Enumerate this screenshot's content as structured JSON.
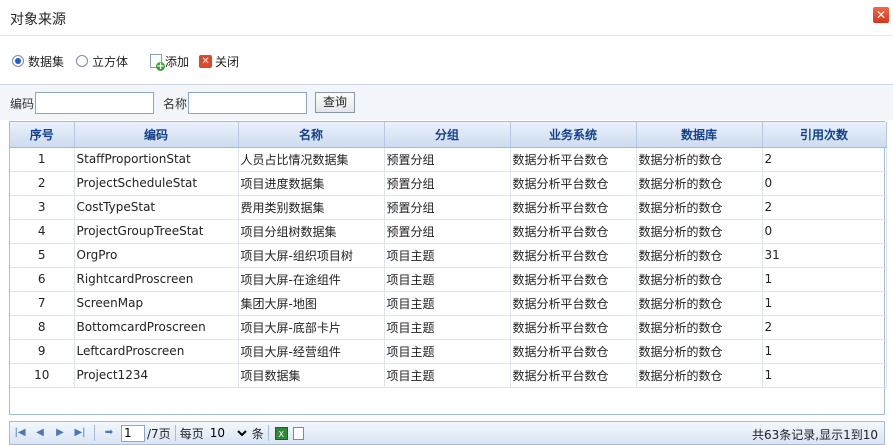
{
  "dialog": {
    "title": "对象来源",
    "close_label": "✕"
  },
  "toolbar": {
    "radio_dataset": "数据集",
    "radio_cube": "立方体",
    "add_label": "添加",
    "close_label": "关闭"
  },
  "filter": {
    "code_label": "编码",
    "code_value": "",
    "name_label": "名称",
    "name_value": "",
    "query_label": "查询"
  },
  "table": {
    "headers": [
      "序号",
      "编码",
      "名称",
      "分组",
      "业务系统",
      "数据库",
      "引用次数"
    ],
    "rows": [
      [
        "1",
        "StaffProportionStat",
        "人员占比情况数据集",
        "预置分组",
        "数据分析平台数仓",
        "数据分析的数仓",
        "2"
      ],
      [
        "2",
        "ProjectScheduleStat",
        "项目进度数据集",
        "预置分组",
        "数据分析平台数仓",
        "数据分析的数仓",
        "0"
      ],
      [
        "3",
        "CostTypeStat",
        "费用类别数据集",
        "预置分组",
        "数据分析平台数仓",
        "数据分析的数仓",
        "2"
      ],
      [
        "4",
        "ProjectGroupTreeStat",
        "项目分组树数据集",
        "预置分组",
        "数据分析平台数仓",
        "数据分析的数仓",
        "0"
      ],
      [
        "5",
        "OrgPro",
        "项目大屏-组织项目树",
        "项目主题",
        "数据分析平台数仓",
        "数据分析的数仓",
        "31"
      ],
      [
        "6",
        "RightcardProscreen",
        "项目大屏-在途组件",
        "项目主题",
        "数据分析平台数仓",
        "数据分析的数仓",
        "1"
      ],
      [
        "7",
        "ScreenMap",
        "集团大屏-地图",
        "项目主题",
        "数据分析平台数仓",
        "数据分析的数仓",
        "1"
      ],
      [
        "8",
        "BottomcardProscreen",
        "项目大屏-底部卡片",
        "项目主题",
        "数据分析平台数仓",
        "数据分析的数仓",
        "2"
      ],
      [
        "9",
        "LeftcardProscreen",
        "项目大屏-经营组件",
        "项目主题",
        "数据分析平台数仓",
        "数据分析的数仓",
        "1"
      ],
      [
        "10",
        "Project1234",
        "项目数据集",
        "项目主题",
        "数据分析平台数仓",
        "数据分析的数仓",
        "1"
      ]
    ]
  },
  "pager": {
    "current_page": "1",
    "total_pages_label": "/7页",
    "per_page_label": "每页",
    "per_page_value": "10",
    "per_page_unit": "条",
    "info": "共63条记录,显示1到10"
  },
  "colors": {
    "header_text": "#15428b",
    "grid_border": "#a9bcd6",
    "close_red": "#d8361c"
  }
}
